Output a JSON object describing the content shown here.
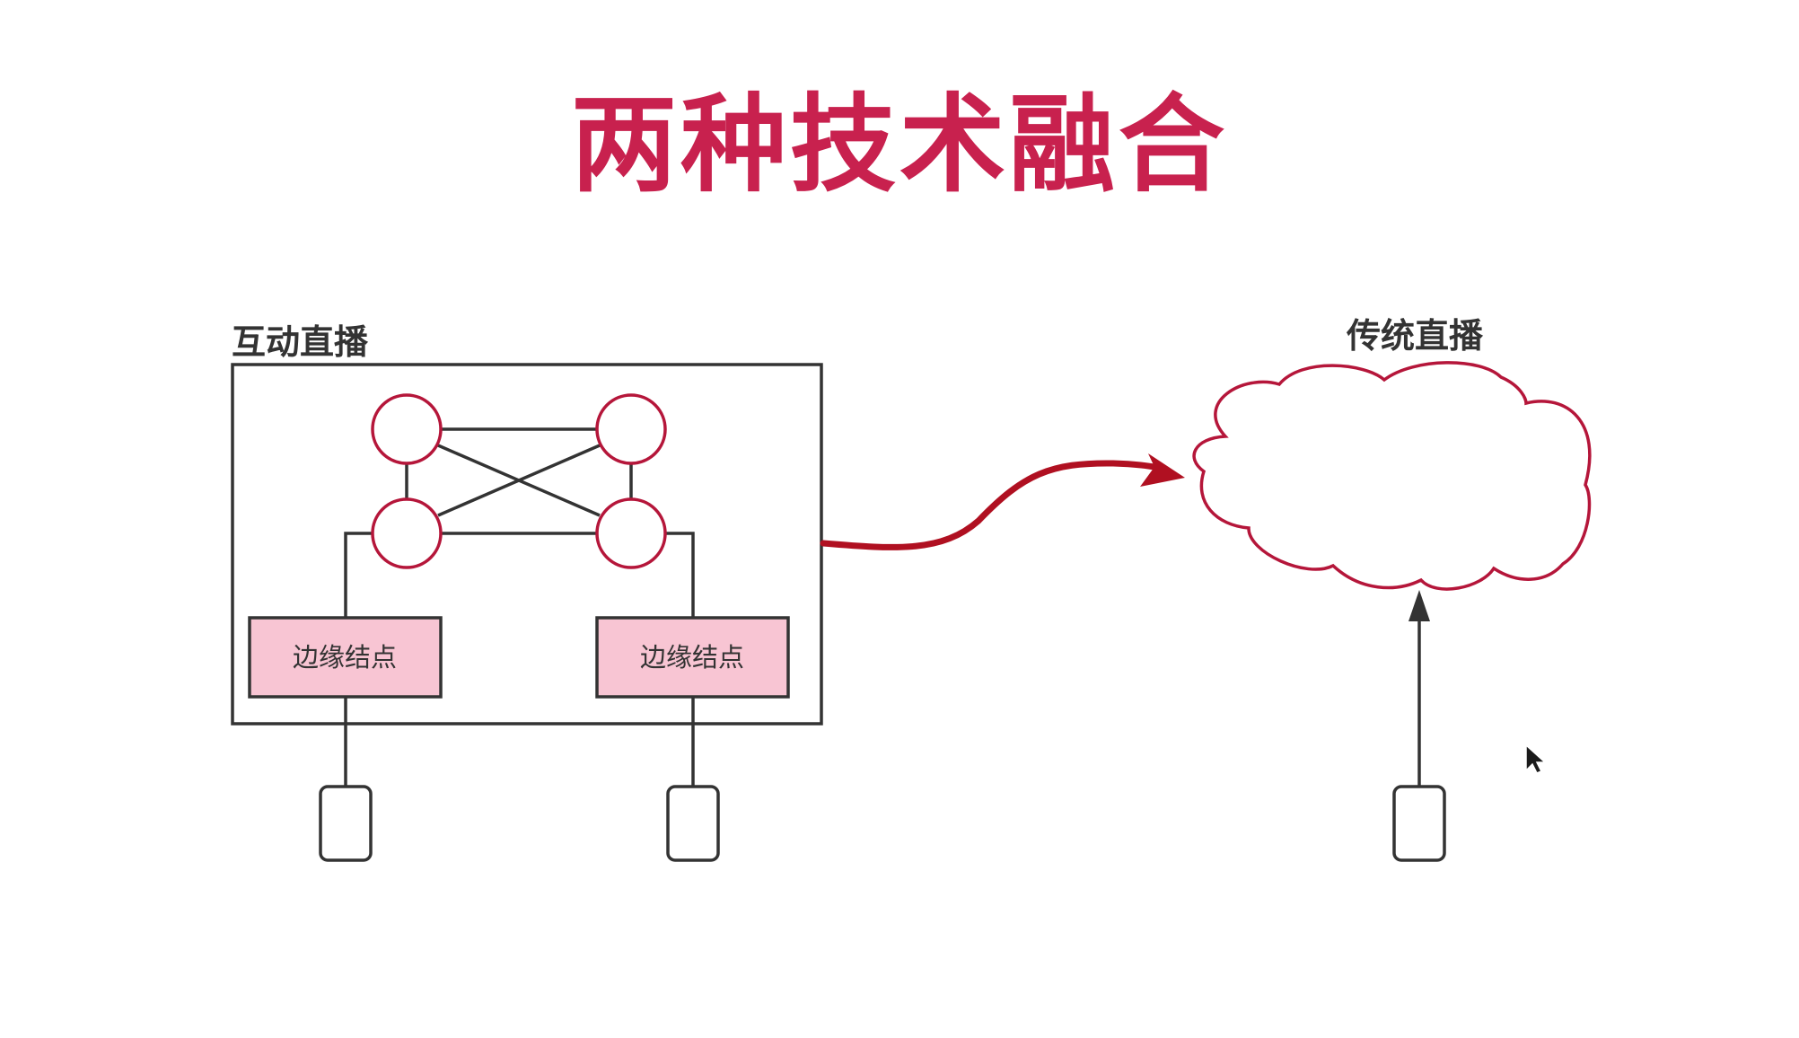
{
  "title": "两种技术融合",
  "interactive_group": {
    "label": "互动直播",
    "edge_node_label": "边缘结点"
  },
  "traditional_group": {
    "label": "传统直播"
  },
  "colors": {
    "title": "#c8214e",
    "accent_stroke": "#b5163a",
    "edge_node_fill": "#f8c5d3",
    "line": "#333333",
    "flow_arrow": "#b01021"
  }
}
